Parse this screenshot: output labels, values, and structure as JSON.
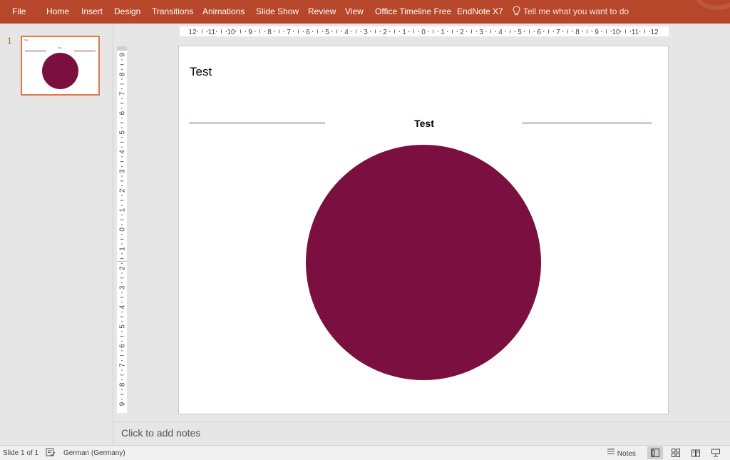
{
  "ribbon": {
    "tabs": [
      "File",
      "Home",
      "Insert",
      "Design",
      "Transitions",
      "Animations",
      "Slide Show",
      "Review",
      "View",
      "Office Timeline Free",
      "EndNote X7"
    ],
    "tell_me": "Tell me what you want to do",
    "tell_me_icon": "lightbulb-icon"
  },
  "thumbnail_pane": {
    "slide_number": "1",
    "thumb_title": "Test",
    "thumb_subtitle": "Test"
  },
  "rulers": {
    "horizontal_labels": [
      "12",
      "11",
      "10",
      "9",
      "8",
      "7",
      "6",
      "5",
      "4",
      "3",
      "2",
      "1",
      "0",
      "1",
      "2",
      "3",
      "4",
      "5",
      "6",
      "7",
      "8",
      "9",
      "10",
      "11",
      "12"
    ],
    "vertical_labels": [
      "9",
      "8",
      "7",
      "6",
      "5",
      "4",
      "3",
      "2",
      "1",
      "0",
      "1",
      "2",
      "3",
      "4",
      "5",
      "6",
      "7",
      "8",
      "9"
    ]
  },
  "slide": {
    "title": "Test",
    "subtitle": "Test",
    "circle_color": "#7b0f40",
    "line_color": "#8a3b55"
  },
  "notes": {
    "placeholder": "Click to add notes"
  },
  "status_bar": {
    "slide_indicator": "Slide 1 of 1",
    "spellcheck_icon": "spellcheck-icon",
    "language": "German (Germany)",
    "notes_label": "Notes",
    "view_icons": [
      "normal-view-icon",
      "slide-sorter-icon",
      "reading-view-icon",
      "slide-show-icon"
    ]
  },
  "colors": {
    "ribbon": "#b7472a",
    "thumb_border": "#e0794a",
    "accent_circle": "#7b0f40"
  }
}
